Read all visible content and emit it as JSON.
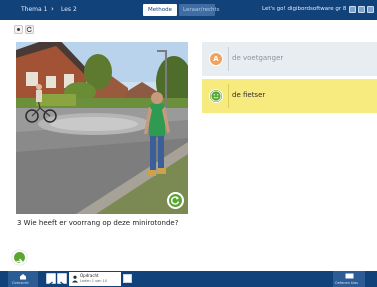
{
  "topbar": {
    "theme_label": "Thema 1",
    "lesson_label": "Les 2",
    "tab_method": "Methode",
    "tab_teacher": "Leraar/rechts",
    "product_title": "Let's go! digibordsoftware gr 8"
  },
  "exercise": {
    "question": "3 Wie heeft er voorrang op deze minirotonde?",
    "answers": [
      {
        "badge": "A",
        "label": "de voetganger",
        "color": "#f0a35e"
      },
      {
        "badge": "B",
        "label": "de fietser",
        "color": "#5ba632"
      }
    ]
  },
  "bottombar": {
    "left_label": "Overzicht",
    "activity_title": "Opdracht",
    "activity_sub": "Leden 1 van 10",
    "right_label": "Oefenen klas"
  },
  "colors": {
    "header_blue": "#12427a",
    "selected_answer": "#f7ea7f",
    "unselected_answer": "#e8edf1",
    "accent_green": "#5ba632"
  },
  "icons": [
    "stop-icon",
    "replay-icon",
    "refresh-icon",
    "arrow-right-icon",
    "arrow-left-icon",
    "home-icon",
    "grid-icon",
    "board-icon",
    "close-icon"
  ]
}
